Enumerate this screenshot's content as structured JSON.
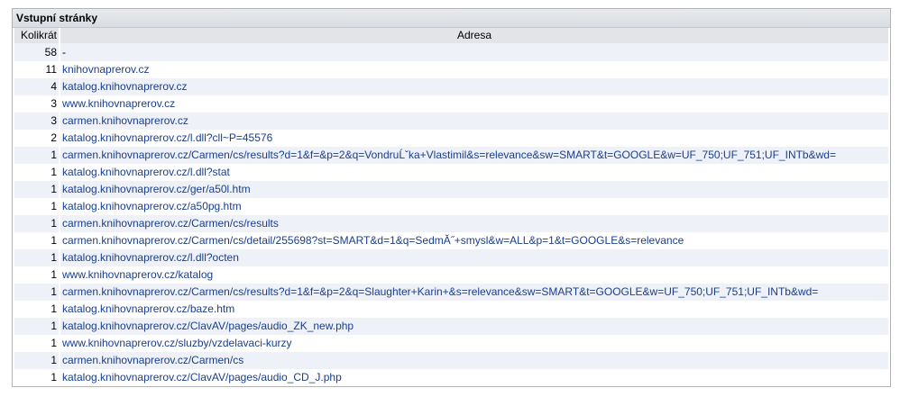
{
  "panel": {
    "title": "Vstupní stránky",
    "headers": {
      "count": "Kolikrát",
      "address": "Adresa"
    },
    "rows": [
      {
        "count": "58",
        "address": "-"
      },
      {
        "count": "11",
        "address": "knihovnaprerov.cz"
      },
      {
        "count": "4",
        "address": "katalog.knihovnaprerov.cz"
      },
      {
        "count": "3",
        "address": "www.knihovnaprerov.cz"
      },
      {
        "count": "3",
        "address": "carmen.knihovnaprerov.cz"
      },
      {
        "count": "2",
        "address": "katalog.knihovnaprerov.cz/l.dll?cll~P=45576"
      },
      {
        "count": "1",
        "address": "carmen.knihovnaprerov.cz/Carmen/cs/results?d=1&f=&p=2&q=VondruĹˇka+Vlastimil&s=relevance&sw=SMART&t=GOOGLE&w=UF_750;UF_751;UF_INTb&wd="
      },
      {
        "count": "1",
        "address": "katalog.knihovnaprerov.cz/l.dll?stat"
      },
      {
        "count": "1",
        "address": "katalog.knihovnaprerov.cz/ger/a50l.htm"
      },
      {
        "count": "1",
        "address": "katalog.knihovnaprerov.cz/a50pg.htm"
      },
      {
        "count": "1",
        "address": "carmen.knihovnaprerov.cz/Carmen/cs/results"
      },
      {
        "count": "1",
        "address": "carmen.knihovnaprerov.cz/Carmen/cs/detail/255698?st=SMART&d=1&q=SedmĂ˝+smysl&w=ALL&p=1&t=GOOGLE&s=relevance"
      },
      {
        "count": "1",
        "address": "katalog.knihovnaprerov.cz/l.dll?octen"
      },
      {
        "count": "1",
        "address": "www.knihovnaprerov.cz/katalog"
      },
      {
        "count": "1",
        "address": "carmen.knihovnaprerov.cz/Carmen/cs/results?d=1&f=&p=2&q=Slaughter+Karin+&s=relevance&sw=SMART&t=GOOGLE&w=UF_750;UF_751;UF_INTb&wd="
      },
      {
        "count": "1",
        "address": "katalog.knihovnaprerov.cz/baze.htm"
      },
      {
        "count": "1",
        "address": "katalog.knihovnaprerov.cz/ClavAV/pages/audio_ZK_new.php"
      },
      {
        "count": "1",
        "address": "www.knihovnaprerov.cz/sluzby/vzdelavaci-kurzy"
      },
      {
        "count": "1",
        "address": "carmen.knihovnaprerov.cz/Carmen/cs"
      },
      {
        "count": "1",
        "address": "katalog.knihovnaprerov.cz/ClavAV/pages/audio_CD_J.php"
      }
    ]
  }
}
